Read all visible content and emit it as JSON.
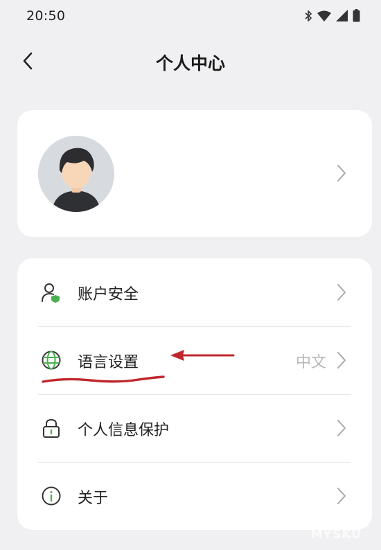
{
  "status_bar": {
    "time": "20:50",
    "icons": [
      "bluetooth-icon",
      "wifi-icon",
      "cell-signal-icon",
      "battery-icon"
    ]
  },
  "header": {
    "title": "个人中心",
    "back_icon": "chevron-left-icon"
  },
  "profile": {
    "avatar": "avatar-icon"
  },
  "menu": {
    "items": [
      {
        "label": "账户安全",
        "value": "",
        "icon": "account-security-icon"
      },
      {
        "label": "语言设置",
        "value": "中文",
        "icon": "globe-icon"
      },
      {
        "label": "个人信息保护",
        "value": "",
        "icon": "lock-icon"
      },
      {
        "label": "关于",
        "value": "",
        "icon": "info-icon"
      }
    ]
  },
  "colors": {
    "background": "#f0f0f2",
    "card": "#ffffff",
    "accent_green": "#4caf50",
    "annotation_red": "#c0272d"
  },
  "watermark": "MYSKU"
}
